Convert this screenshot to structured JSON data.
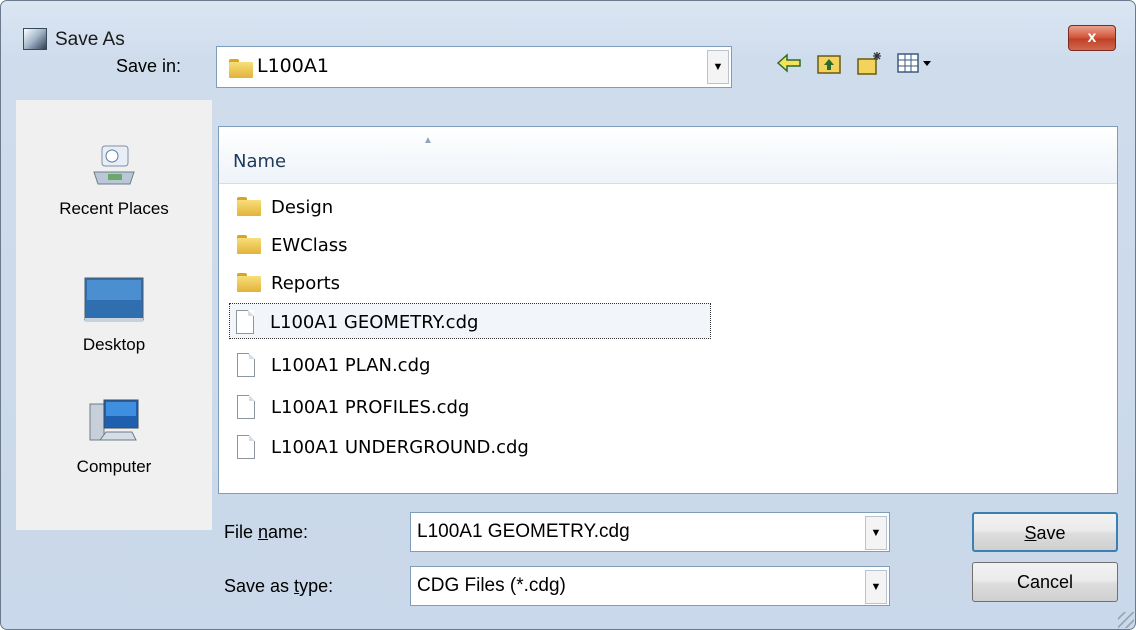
{
  "window": {
    "title": "Save As",
    "close_label": "x"
  },
  "toolbar": {
    "save_in_label": "Save in:",
    "save_in_value": "L100A1",
    "icons": [
      "back-arrow-icon",
      "up-folder-icon",
      "new-folder-icon",
      "view-menu-icon"
    ]
  },
  "places": [
    {
      "label": "Recent Places",
      "icon": "recent-places-icon"
    },
    {
      "label": "Desktop",
      "icon": "desktop-icon"
    },
    {
      "label": "Computer",
      "icon": "computer-icon"
    }
  ],
  "file_list": {
    "column_header": "Name",
    "items": [
      {
        "name": "Design",
        "type": "folder"
      },
      {
        "name": "EWClass",
        "type": "folder"
      },
      {
        "name": "Reports",
        "type": "folder"
      },
      {
        "name": "L100A1 GEOMETRY.cdg",
        "type": "file",
        "selected": true
      },
      {
        "name": "L100A1 PLAN.cdg",
        "type": "file"
      },
      {
        "name": "L100A1 PROFILES.cdg",
        "type": "file"
      },
      {
        "name": "L100A1 UNDERGROUND.cdg",
        "type": "file"
      }
    ]
  },
  "form": {
    "file_name_label_pre": "File ",
    "file_name_label_key": "n",
    "file_name_label_post": "ame:",
    "file_name_value": "L100A1 GEOMETRY.cdg",
    "save_type_label_pre": "Save as ",
    "save_type_label_key": "t",
    "save_type_label_post": "ype:",
    "save_type_value": "CDG Files (*.cdg)"
  },
  "buttons": {
    "save_key": "S",
    "save_rest": "ave",
    "cancel": "Cancel"
  },
  "colors": {
    "accent": "#3c7fb1",
    "title_bg": "#cfdcec",
    "close": "#c0402a"
  }
}
